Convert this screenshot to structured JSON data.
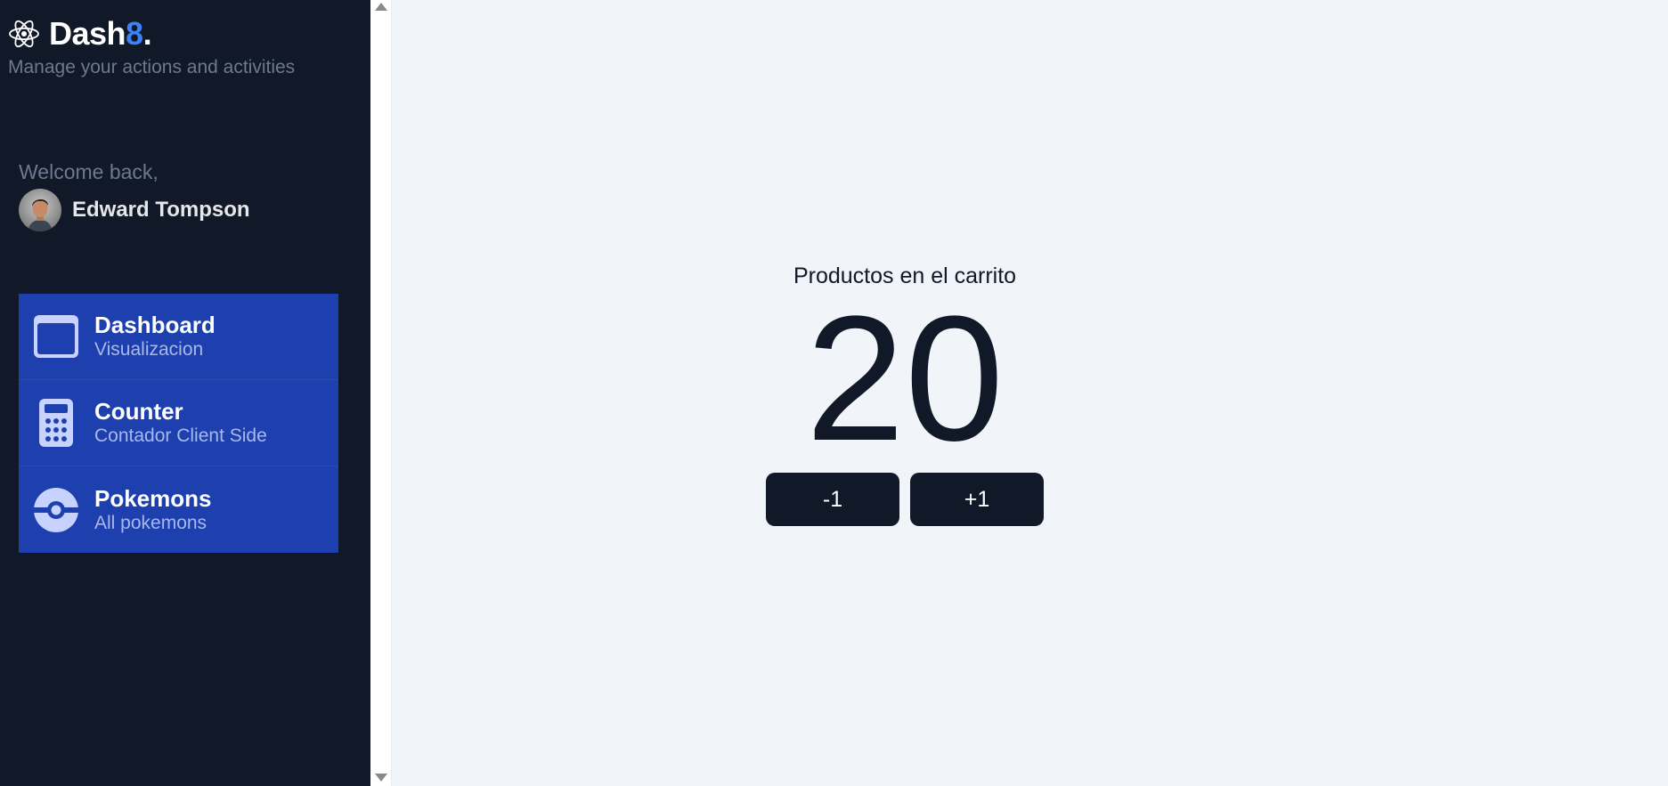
{
  "brand": {
    "name": "Dash",
    "accent": "8",
    "dot": ".",
    "icon": "react-atom-icon",
    "subtitle": "Manage your actions and activities"
  },
  "user": {
    "welcome": "Welcome back,",
    "name": "Edward Tompson"
  },
  "nav": {
    "items": [
      {
        "title": "Dashboard",
        "subtitle": "Visualizacion",
        "icon": "browser-window-icon"
      },
      {
        "title": "Counter",
        "subtitle": "Contador Client Side",
        "icon": "calculator-icon"
      },
      {
        "title": "Pokemons",
        "subtitle": "All pokemons",
        "icon": "pokeball-icon"
      }
    ]
  },
  "counter": {
    "label": "Productos en el carrito",
    "value": "20",
    "decrement_label": "-1",
    "increment_label": "+1"
  },
  "colors": {
    "sidebar_bg": "#111827",
    "nav_bg": "#1e40af",
    "accent": "#3b82f6",
    "main_bg": "#f1f4f9",
    "button_bg": "#111827"
  }
}
